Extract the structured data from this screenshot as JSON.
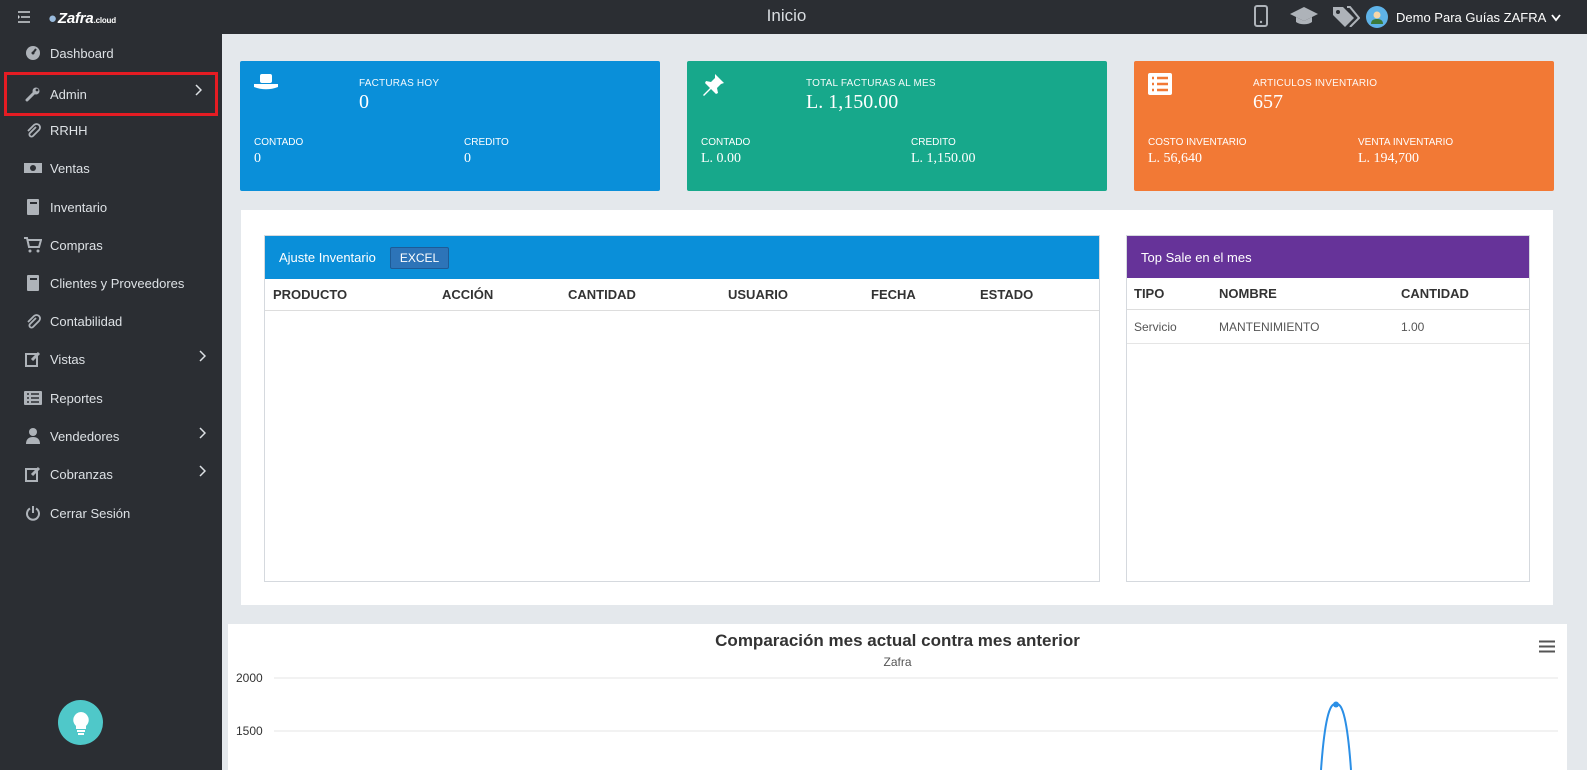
{
  "brand": {
    "logo": "Zafra",
    "logo_suffix": ".cloud"
  },
  "topbar": {
    "title": "Inicio",
    "user_name": "Demo Para Guías ZAFRA"
  },
  "sidebar": {
    "items": [
      {
        "label": "Dashboard",
        "icon": "dashboard-icon"
      },
      {
        "label": "Admin",
        "icon": "wrench-icon",
        "has_submenu": true
      },
      {
        "label": "RRHH",
        "icon": "paperclip-icon"
      },
      {
        "label": "Ventas",
        "icon": "money-icon"
      },
      {
        "label": "Inventario",
        "icon": "book-icon"
      },
      {
        "label": "Compras",
        "icon": "cart-icon"
      },
      {
        "label": "Clientes y Proveedores",
        "icon": "book-icon"
      },
      {
        "label": "Contabilidad",
        "icon": "paperclip-icon"
      },
      {
        "label": "Vistas",
        "icon": "edit-icon",
        "has_submenu": true
      },
      {
        "label": "Reportes",
        "icon": "list-icon"
      },
      {
        "label": "Vendedores",
        "icon": "user-icon",
        "has_submenu": true
      },
      {
        "label": "Cobranzas",
        "icon": "edit-icon",
        "has_submenu": true
      },
      {
        "label": "Cerrar Sesión",
        "icon": "power-icon"
      }
    ]
  },
  "cards": [
    {
      "color": "#0a8fd9",
      "icon": "hat-icon",
      "main_label": "FACTURAS HOY",
      "main_value": "0",
      "sub1_label": "CONTADO",
      "sub1_value": "0",
      "sub2_label": "CREDITO",
      "sub2_value": "0"
    },
    {
      "color": "#17a88b",
      "icon": "pin-icon",
      "main_label": "TOTAL FACTURAS AL MES",
      "main_value": "L. 1,150.00",
      "sub1_label": "CONTADO",
      "sub1_value": "L. 0.00",
      "sub2_label": "CREDITO",
      "sub2_value": "L. 1,150.00"
    },
    {
      "color": "#f27935",
      "icon": "list-icon",
      "main_label": "ARTICULOS INVENTARIO",
      "main_value": "657",
      "sub1_label": "COSTO INVENTARIO",
      "sub1_value": "L. 56,640",
      "sub2_label": "VENTA INVENTARIO",
      "sub2_value": "L. 194,700"
    }
  ],
  "ajuste": {
    "title": "Ajuste Inventario",
    "excel_label": "EXCEL",
    "columns": [
      "PRODUCTO",
      "ACCIÓN",
      "CANTIDAD",
      "USUARIO",
      "FECHA",
      "ESTADO"
    ]
  },
  "top_sale": {
    "title": "Top Sale en el mes",
    "columns": [
      "TIPO",
      "NOMBRE",
      "CANTIDAD"
    ],
    "rows": [
      [
        "Servicio",
        "MANTENIMIENTO",
        "1.00"
      ]
    ]
  },
  "chart_data": {
    "type": "line",
    "title": "Comparación mes actual contra mes anterior",
    "subtitle": "Zafra",
    "y_ticks": [
      "2000",
      "1500"
    ],
    "ylim": [
      1000,
      2000
    ],
    "series": [
      {
        "color": "#2b8fe6",
        "peak_value": 1750
      }
    ]
  },
  "colors": {
    "sidebar_bg": "#2b2e33",
    "highlight": "#e51c23",
    "top_sale_header": "#663399",
    "ajuste_header": "#0a8fd9"
  }
}
